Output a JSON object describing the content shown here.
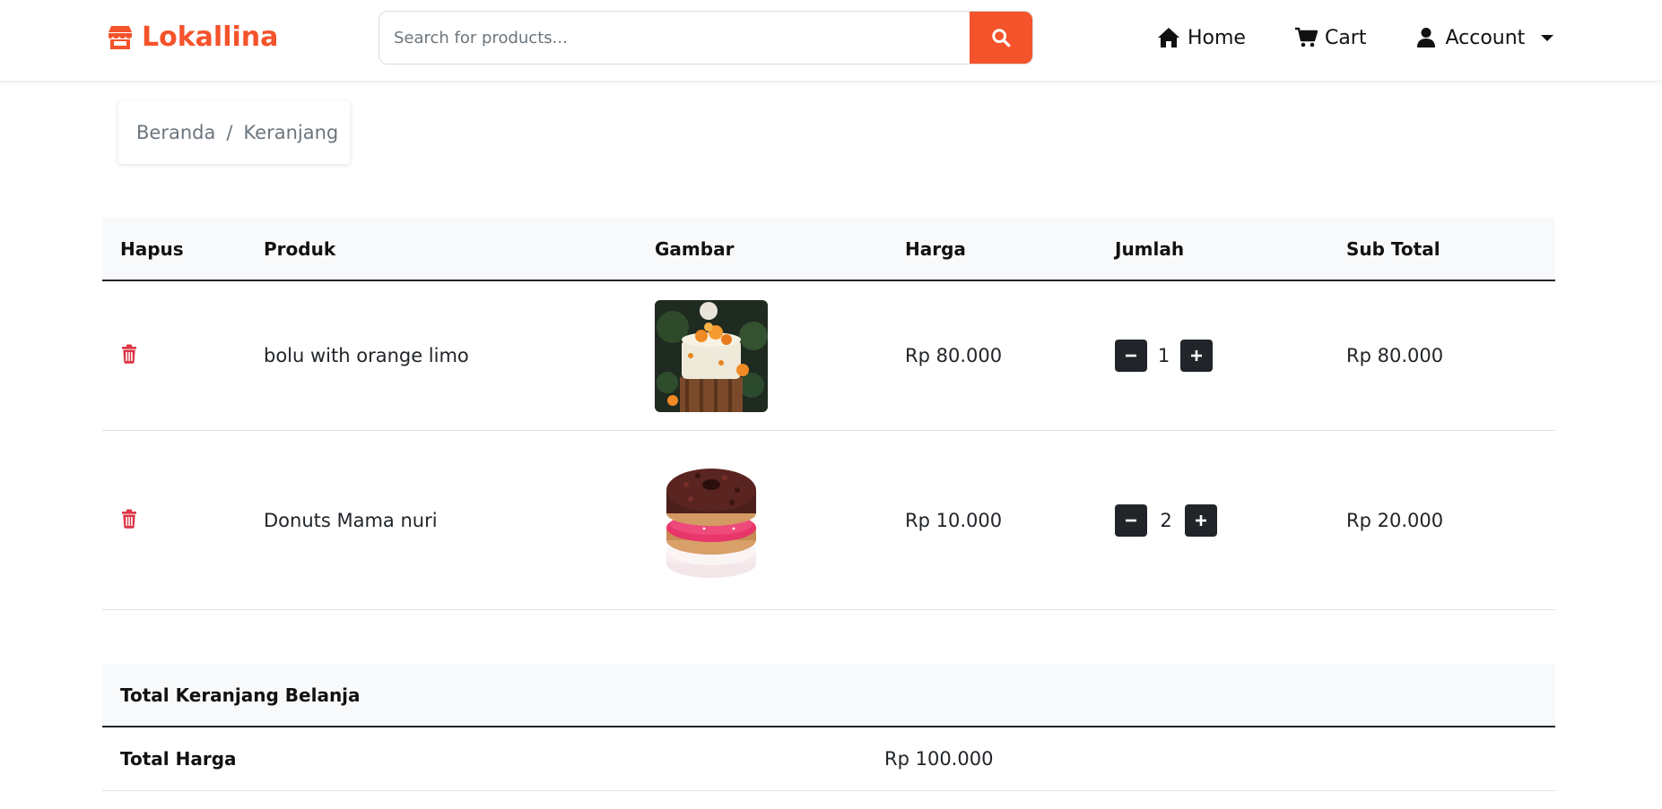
{
  "navbar": {
    "brand": "Lokallina",
    "search_placeholder": "Search for products...",
    "links": {
      "home": "Home",
      "cart": "Cart",
      "account": "Account"
    },
    "accent_color": "#f4532b"
  },
  "breadcrumb": {
    "items": [
      "Beranda",
      "Keranjang"
    ],
    "separator": "/"
  },
  "cart": {
    "headers": {
      "hapus": "Hapus",
      "produk": "Produk",
      "gambar": "Gambar",
      "harga": "Harga",
      "jumlah": "Jumlah",
      "subtotal": "Sub Total"
    },
    "rows": [
      {
        "name": "bolu with orange limo",
        "image": "orange-cake-photo",
        "price": "Rp 80.000",
        "qty": "1",
        "subtotal": "Rp 80.000"
      },
      {
        "name": "Donuts Mama nuri",
        "image": "donut-stack-photo",
        "price": "Rp 10.000",
        "qty": "2",
        "subtotal": "Rp 20.000"
      }
    ]
  },
  "totals": {
    "title": "Total Keranjang Belanja",
    "label": "Total Harga",
    "value": "Rp 100.000"
  }
}
